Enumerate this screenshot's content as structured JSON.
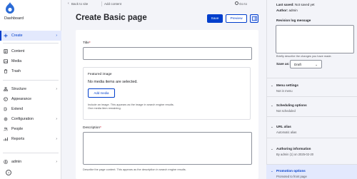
{
  "sidebar": {
    "dashboard": "Dashboard",
    "items": [
      {
        "label": "Create",
        "icon": "plus-icon",
        "chevron": "›"
      },
      {
        "label": "Content",
        "icon": "content-icon"
      },
      {
        "label": "Media",
        "icon": "media-icon"
      },
      {
        "label": "Trash",
        "icon": "trash-icon"
      },
      {
        "label": "Structure",
        "icon": "structure-icon",
        "chevron": "›"
      },
      {
        "label": "Appearance",
        "icon": "appearance-icon"
      },
      {
        "label": "Extend",
        "icon": "extend-icon"
      },
      {
        "label": "Configuration",
        "icon": "configuration-icon",
        "chevron": "›"
      },
      {
        "label": "People",
        "icon": "people-icon"
      },
      {
        "label": "Reports",
        "icon": "reports-icon",
        "chevron": "›"
      }
    ],
    "user": {
      "label": "admin",
      "chevron": "›"
    }
  },
  "topbar": {
    "back": "Back to site",
    "add_content": "Add content",
    "goto": "Go to"
  },
  "page": {
    "title": "Create Basic page",
    "save": "Save",
    "preview": "Preview"
  },
  "form": {
    "title_label": "Title",
    "required_mark": "*",
    "featured_image": {
      "legend": "Featured image",
      "empty": "No media items are selected.",
      "add_media": "Add media",
      "help_line1": "Include an image. This appears as the image in search engine results.",
      "help_line2": "One media item remaining."
    },
    "description_label": "Description",
    "description_help": "Describe the page content. This appears as the description in search engine results."
  },
  "meta": {
    "last_saved_label": "Last saved:",
    "last_saved_value": "Not saved yet",
    "author_label": "Author:",
    "author_value": "admin",
    "revision_label": "Revision log message",
    "revision_help": "Briefly describe the changes you have made.",
    "save_as_label": "Save as:",
    "save_as_value": "Draft",
    "sections": [
      {
        "title": "Menu settings",
        "sub": "Not in menu"
      },
      {
        "title": "Scheduling options",
        "sub": "Not scheduled"
      },
      {
        "title": "URL alias",
        "sub": "Automatic alias"
      },
      {
        "title": "Authoring information",
        "sub": "By admin (1) on 2025-02-20"
      },
      {
        "title": "Promotion options",
        "sub": "Promoted to front page"
      }
    ]
  },
  "colors": {
    "accent": "#003ecc",
    "active_bg": "#e3e9fd",
    "page_bg": "#f3f4f9"
  }
}
